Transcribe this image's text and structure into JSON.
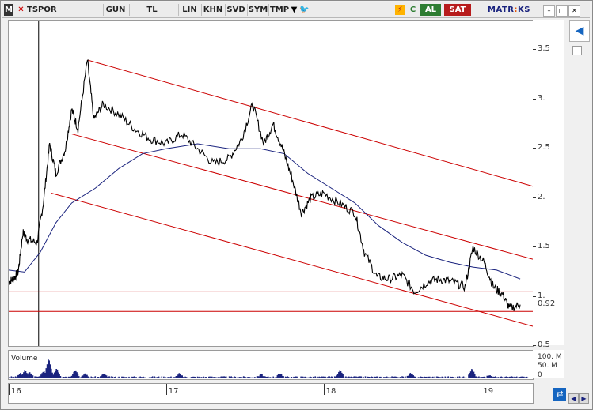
{
  "toolbar": {
    "m_label": "M",
    "symbol": "TSPOR",
    "period": "GUN",
    "currency": "TL",
    "scale": "LIN",
    "khn": "KHN",
    "svd": "SVD",
    "sym": "SYM",
    "tmp": "TMP",
    "buy": "AL",
    "sell": "SAT",
    "brand_part1": "MATR",
    "brand_part2": "KS",
    "colors": {
      "buy": "#2e7d32",
      "sell": "#b71c1c",
      "twitter": "#1da1f2",
      "refresh": "#2e7d32",
      "lightning": "#e65100"
    }
  },
  "chart": {
    "volume_label": "Volume",
    "last_price": "0.92",
    "line_color": "#000000",
    "ma_color": "#1a237e",
    "channel_color": "#cc0000"
  },
  "chart_data": {
    "type": "line",
    "yticks": [
      "3.5",
      "3.",
      "2.5",
      "2.",
      "1.5",
      "1.",
      "0.5"
    ],
    "xticks": [
      "16",
      "17",
      "18",
      "19"
    ],
    "volume_ticks": [
      "100. M",
      "50. M",
      "0"
    ],
    "price_series": [
      [
        2016.0,
        1.15
      ],
      [
        2016.03,
        1.18
      ],
      [
        2016.06,
        1.25
      ],
      [
        2016.09,
        1.65
      ],
      [
        2016.12,
        1.58
      ],
      [
        2016.18,
        1.55
      ],
      [
        2016.22,
        1.95
      ],
      [
        2016.26,
        2.55
      ],
      [
        2016.3,
        2.25
      ],
      [
        2016.36,
        2.5
      ],
      [
        2016.4,
        2.9
      ],
      [
        2016.44,
        2.7
      ],
      [
        2016.5,
        3.4
      ],
      [
        2016.54,
        2.8
      ],
      [
        2016.6,
        2.95
      ],
      [
        2016.7,
        2.85
      ],
      [
        2016.8,
        2.7
      ],
      [
        2016.9,
        2.6
      ],
      [
        2017.0,
        2.55
      ],
      [
        2017.1,
        2.65
      ],
      [
        2017.2,
        2.5
      ],
      [
        2017.3,
        2.35
      ],
      [
        2017.4,
        2.4
      ],
      [
        2017.48,
        2.6
      ],
      [
        2017.55,
        2.95
      ],
      [
        2017.62,
        2.55
      ],
      [
        2017.68,
        2.75
      ],
      [
        2017.74,
        2.5
      ],
      [
        2017.8,
        2.2
      ],
      [
        2017.86,
        1.85
      ],
      [
        2017.92,
        2.0
      ],
      [
        2018.0,
        2.05
      ],
      [
        2018.1,
        1.95
      ],
      [
        2018.2,
        1.85
      ],
      [
        2018.26,
        1.45
      ],
      [
        2018.34,
        1.2
      ],
      [
        2018.42,
        1.18
      ],
      [
        2018.5,
        1.22
      ],
      [
        2018.58,
        1.05
      ],
      [
        2018.66,
        1.15
      ],
      [
        2018.74,
        1.18
      ],
      [
        2018.82,
        1.15
      ],
      [
        2018.9,
        1.1
      ],
      [
        2018.95,
        1.5
      ],
      [
        2019.02,
        1.35
      ],
      [
        2019.08,
        1.1
      ],
      [
        2019.14,
        1.02
      ],
      [
        2019.18,
        0.88
      ],
      [
        2019.25,
        0.92
      ]
    ],
    "moving_average": [
      [
        2016.0,
        1.27
      ],
      [
        2016.1,
        1.25
      ],
      [
        2016.2,
        1.45
      ],
      [
        2016.3,
        1.75
      ],
      [
        2016.4,
        1.95
      ],
      [
        2016.55,
        2.1
      ],
      [
        2016.7,
        2.3
      ],
      [
        2016.85,
        2.45
      ],
      [
        2017.0,
        2.5
      ],
      [
        2017.2,
        2.55
      ],
      [
        2017.4,
        2.5
      ],
      [
        2017.6,
        2.5
      ],
      [
        2017.75,
        2.45
      ],
      [
        2017.9,
        2.25
      ],
      [
        2018.05,
        2.1
      ],
      [
        2018.2,
        1.95
      ],
      [
        2018.35,
        1.72
      ],
      [
        2018.5,
        1.55
      ],
      [
        2018.65,
        1.42
      ],
      [
        2018.8,
        1.35
      ],
      [
        2018.95,
        1.3
      ],
      [
        2019.1,
        1.27
      ],
      [
        2019.25,
        1.18
      ]
    ],
    "channel_lines": [
      {
        "from": [
          2016.5,
          3.4
        ],
        "to": [
          2019.33,
          2.12
        ]
      },
      {
        "from": [
          2016.4,
          2.65
        ],
        "to": [
          2019.33,
          1.38
        ]
      },
      {
        "from": [
          2016.27,
          2.05
        ],
        "to": [
          2019.33,
          0.7
        ]
      },
      {
        "from": [
          2016.0,
          1.05
        ],
        "to": [
          2019.33,
          1.05
        ]
      },
      {
        "from": [
          2016.0,
          0.85
        ],
        "to": [
          2019.33,
          0.85
        ]
      }
    ],
    "volume_peaks": [
      [
        2016.07,
        20
      ],
      [
        2016.1,
        35
      ],
      [
        2016.13,
        25
      ],
      [
        2016.22,
        30
      ],
      [
        2016.25,
        85
      ],
      [
        2016.3,
        40
      ],
      [
        2016.42,
        35
      ],
      [
        2016.48,
        20
      ],
      [
        2016.6,
        18
      ],
      [
        2017.08,
        20
      ],
      [
        2017.6,
        15
      ],
      [
        2017.72,
        20
      ],
      [
        2018.1,
        35
      ],
      [
        2018.55,
        20
      ],
      [
        2018.94,
        38
      ],
      [
        2019.05,
        12
      ]
    ],
    "xlim": [
      2016.0,
      2019.33
    ],
    "ylim": [
      0.5,
      3.8
    ]
  }
}
